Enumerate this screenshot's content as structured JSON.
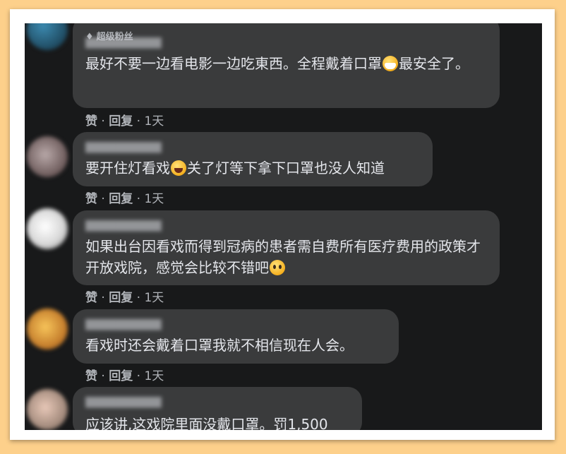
{
  "comments": [
    {
      "badge": "超级粉丝",
      "text_before": "最好不要一边看电影一边吃東西。全程戴着口罩",
      "emoji": "mask-face-emoji",
      "text_after": "最安全了。",
      "actions": {
        "like": "赞",
        "reply": "回复",
        "time": "1天"
      }
    },
    {
      "text_before": "要开住灯看戏",
      "emoji": "rolling-laughing-emoji",
      "text_after": "关了灯等下拿下口罩也没人知道",
      "actions": {
        "like": "赞",
        "reply": "回复",
        "time": "1天"
      }
    },
    {
      "text_before": "如果出台因看戏而得到冠病的患者需自费所有医疗费用的政策才开放戏院，感觉会比较不错吧",
      "emoji": "flushed-face-emoji",
      "text_after": "",
      "actions": {
        "like": "赞",
        "reply": "回复",
        "time": "1天"
      }
    },
    {
      "text_before": "看戏时还会戴着口罩我就不相信现在人会。",
      "actions": {
        "like": "赞",
        "reply": "回复",
        "time": "1天"
      }
    },
    {
      "text_before": "应该讲,这戏院里面没戴口罩。罚1,500"
    }
  ],
  "separator": "·",
  "colors": {
    "page_background": "#fdd08b",
    "screen_background": "#18191a",
    "bubble": "#3a3b3c",
    "text": "#e4e6eb",
    "secondary_text": "#b0b3b8"
  }
}
